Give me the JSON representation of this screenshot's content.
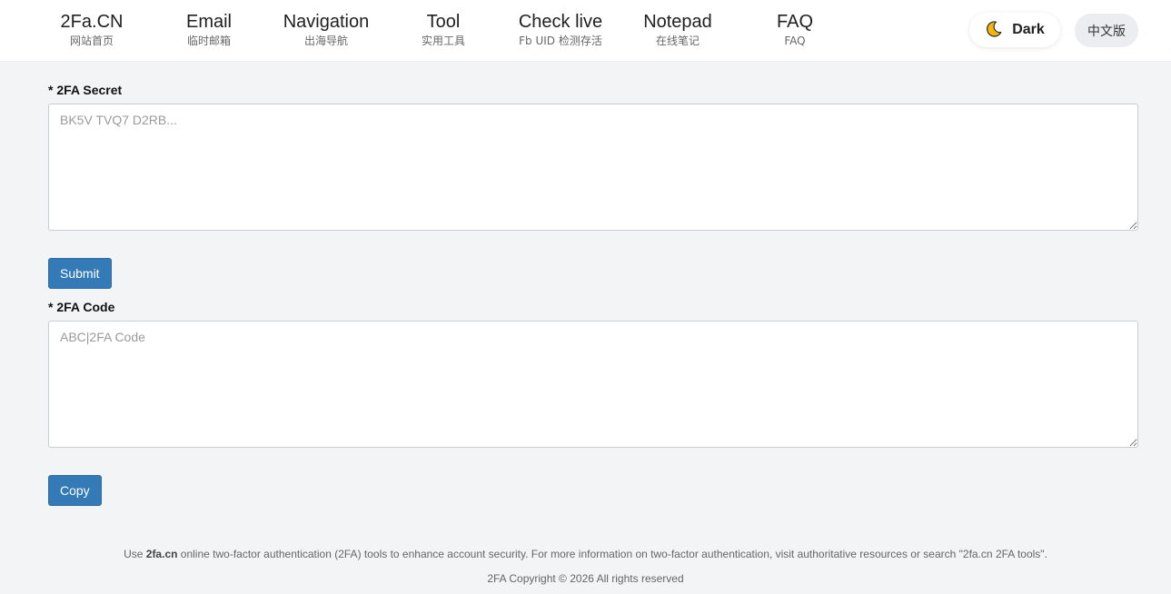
{
  "nav": [
    {
      "title": "2Fa.CN",
      "subtitle": "网站首页"
    },
    {
      "title": "Email",
      "subtitle": "临时邮箱"
    },
    {
      "title": "Navigation",
      "subtitle": "出海导航"
    },
    {
      "title": "Tool",
      "subtitle": "实用工具"
    },
    {
      "title": "Check live",
      "subtitle": "Fb UID 检测存活"
    },
    {
      "title": "Notepad",
      "subtitle": "在线笔记"
    },
    {
      "title": "FAQ",
      "subtitle": "FAQ"
    }
  ],
  "theme_toggle": {
    "icon": "moon-icon",
    "label": "Dark"
  },
  "language_toggle": {
    "label": "中文版"
  },
  "form": {
    "secret_label": "* 2FA Secret",
    "secret_placeholder": "BK5V TVQ7 D2RB...",
    "submit_label": "Submit",
    "code_label": "* 2FA Code",
    "code_placeholder": "ABC|2FA Code",
    "copy_label": "Copy"
  },
  "footer": {
    "prefix": "Use ",
    "brand": "2fa.cn",
    "text": " online two-factor authentication (2FA) tools to enhance account security. For more information on two-factor authentication, visit authoritative resources or search \"2fa.cn 2FA tools\".",
    "copyright": "2FA Copyright © 2026 All rights reserved"
  },
  "colors": {
    "accent": "#337ab7",
    "page_background": "#f3f4f6",
    "header_background": "#ffffff"
  }
}
